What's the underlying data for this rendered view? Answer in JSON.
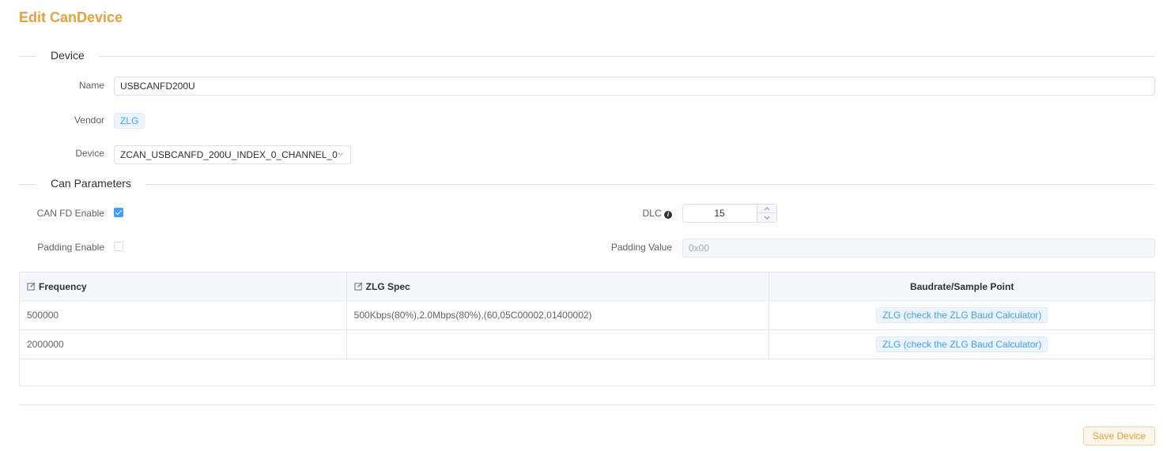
{
  "page": {
    "title": "Edit CanDevice"
  },
  "device_section": {
    "title": "Device",
    "name_label": "Name",
    "name_value": "USBCANFD200U",
    "vendor_label": "Vendor",
    "vendor_value": "ZLG",
    "device_label": "Device",
    "device_value": "ZCAN_USBCANFD_200U_INDEX_0_CHANNEL_0"
  },
  "can_section": {
    "title": "Can Parameters",
    "canfd_label": "CAN FD Enable",
    "canfd_checked": true,
    "padding_label": "Padding Enable",
    "padding_checked": false,
    "dlc_label": "DLC",
    "dlc_value": "15",
    "padding_value_label": "Padding Value",
    "padding_value_placeholder": "0x00"
  },
  "table": {
    "columns": [
      "Frequency",
      "ZLG Spec",
      "Baudrate/Sample Point"
    ],
    "rows": [
      {
        "frequency": "500000",
        "spec": "500Kbps(80%),2.0Mbps(80%),(60,05C00002,01400002)",
        "link": "ZLG (check the ZLG Baud Calculator)"
      },
      {
        "frequency": "2000000",
        "spec": "",
        "link": "ZLG (check the ZLG Baud Calculator)"
      }
    ]
  },
  "actions": {
    "save_label": "Save Device"
  },
  "colors": {
    "accent": "#e6a23c",
    "primary": "#409eff",
    "border": "#dcdfe6"
  },
  "icons": [
    "chevron-down-icon",
    "checkbox-check-icon",
    "info-icon",
    "chevron-up-icon",
    "edit-icon"
  ]
}
